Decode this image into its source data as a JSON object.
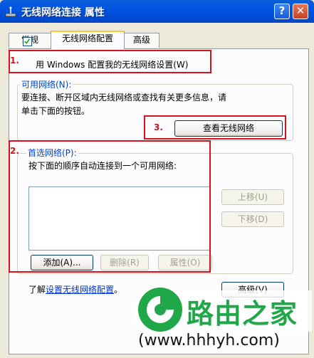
{
  "window": {
    "title": "无线网络连接  属性",
    "help_button": "?",
    "close_button": "✕"
  },
  "tabs": [
    {
      "label": "常规",
      "active": false
    },
    {
      "label": "无线网络配置",
      "active": true
    },
    {
      "label": "高级",
      "active": false
    }
  ],
  "config": {
    "use_windows_checkbox_label": "用 Windows 配置我的无线网络设置(W)",
    "use_windows_checked": true
  },
  "available": {
    "title": "可用网络(N):",
    "desc_line1": "要连接、断开区域内无线网络或查找有关更多信息，请",
    "desc_line2": "单击下面的按钮。",
    "view_button": "查看无线网络"
  },
  "preferred": {
    "title": "首选网络(P):",
    "desc": "按下面的顺序自动连接到一个可用网络:",
    "items": [],
    "move_up_button": "上移(U)",
    "move_down_button": "下移(D)",
    "add_button": "添加(A)...",
    "remove_button": "删除(R)",
    "properties_button": "属性(O)"
  },
  "footer": {
    "learn_prefix": "了解",
    "learn_link": "设置无线网络配置",
    "learn_suffix": "。",
    "advanced_button": "高级(V)"
  },
  "annotations": {
    "marker1": "1.",
    "marker2": "2.",
    "marker3": "3."
  },
  "watermark": {
    "brand": "路由之家",
    "url": "(www.hhhyh.com)",
    "color": "#20a74a"
  },
  "colors": {
    "accent_red": "#d4141c",
    "title_blue": "#0054e3",
    "group_title": "#0046d5"
  }
}
